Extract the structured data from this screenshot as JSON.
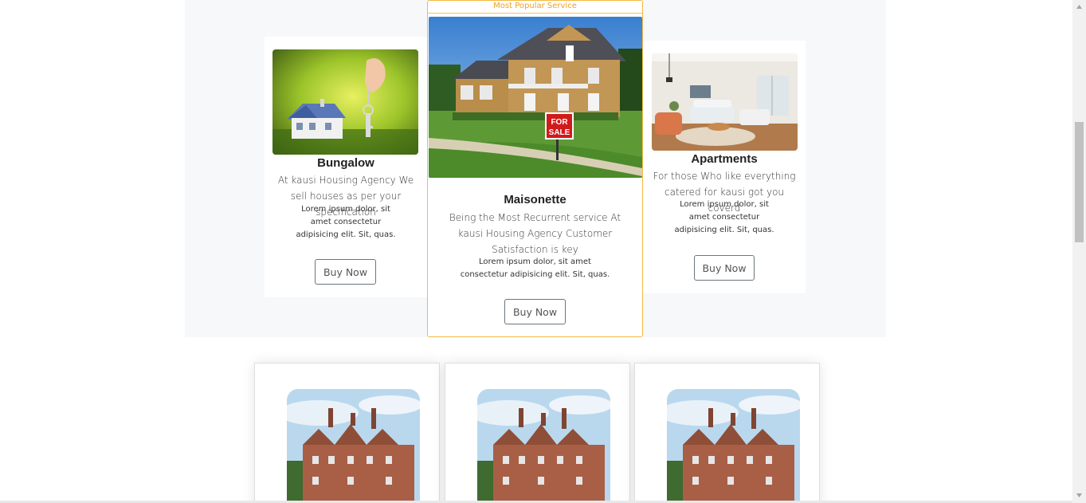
{
  "services": {
    "popular_label": "Most Popular Service",
    "cards": [
      {
        "title": "Bungalow",
        "description": "At kausi Housing Agency We sell houses as per your specification",
        "detail": "Lorem ipsum dolor, sit amet consectetur adipisicing elit. Sit, quas.",
        "button": "Buy Now"
      },
      {
        "title": "Maisonette",
        "description": "Being the Most Recurrent service At kausi Housing Agency Customer Satisfaction is key",
        "detail": "Lorem ipsum dolor, sit amet consectetur adipisicing elit. Sit, quas.",
        "button": "Buy Now",
        "sign_line1": "FOR",
        "sign_line2": "SALE"
      },
      {
        "title": "Apartments",
        "description": "For those Who like everything catered for kausi got you coverd",
        "detail": "Lorem ipsum dolor, sit amet consectetur adipisicing elit. Sit, quas.",
        "button": "Buy Now"
      }
    ]
  },
  "gallery": {
    "items": [
      {
        "image": "manor-house-photo"
      },
      {
        "image": "manor-house-photo"
      },
      {
        "image": "manor-house-photo"
      }
    ]
  },
  "colors": {
    "accent": "#f5b942",
    "section_background": "#f7f8fa",
    "button_border": "#6c757d"
  }
}
